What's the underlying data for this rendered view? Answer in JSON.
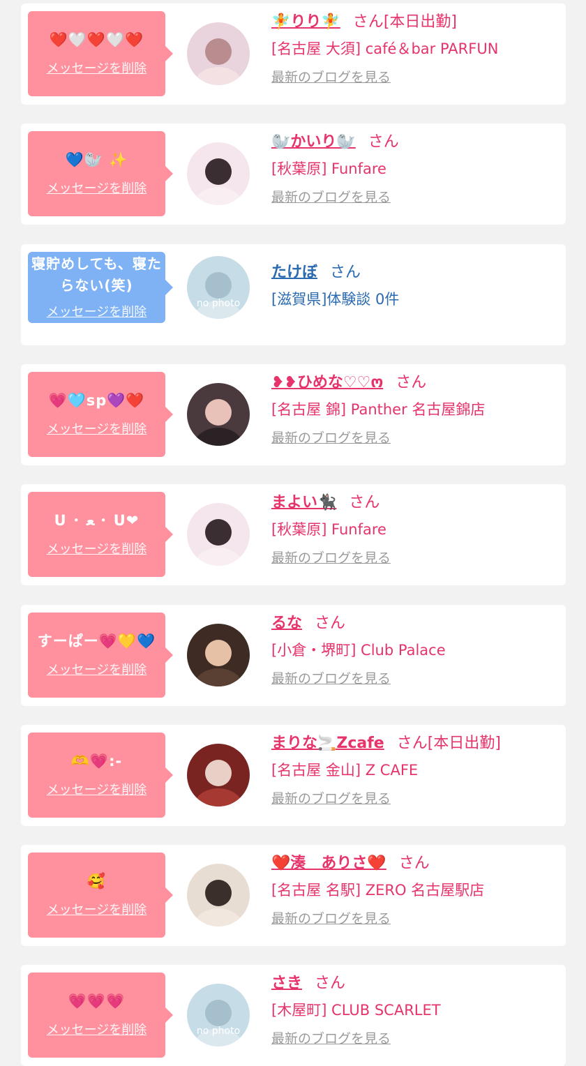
{
  "delete_label": "メッセージを削除",
  "san_label": "さん",
  "blog_label": "最新のブログを見る",
  "colors": {
    "page_bg": "#f2f2f2",
    "card_bg": "#ffffff",
    "female_bubble": "#ff919f",
    "male_bubble": "#7eb2f5",
    "name_pink": "#e6346b",
    "name_blue": "#2a6ab0",
    "blog_gray": "#9a9a9a"
  },
  "messages": [
    {
      "type": "female",
      "message": "❤️🤍❤️🤍❤️",
      "name": "🧚りり🧚",
      "badge": "[本日出勤]",
      "shop": "[名古屋 大須] café＆bar PARFUN",
      "avatar": "photo-avatar-pink",
      "blog": true
    },
    {
      "type": "female",
      "message": "💙🦭 ✨",
      "name": "🦭かいり🦭",
      "badge": "",
      "shop": "[秋葉原] Funfare",
      "avatar": "photo-avatar-lightpink",
      "blog": true
    },
    {
      "type": "male",
      "message": "寝貯めしても、寝たらない(笑)",
      "name": "たけぼ",
      "badge": "",
      "shop": "[滋賀県]体験談 0件",
      "avatar": "no-photo-avatar",
      "avatar_text": "no photo",
      "blog": false
    },
    {
      "type": "female",
      "message": "💗🩵sp💜❤️",
      "name": "❥❥ひめな♡♡ო",
      "badge": "",
      "shop": "[名古屋 錦] Panther 名古屋錦店",
      "avatar": "photo-avatar-dark",
      "blog": true
    },
    {
      "type": "female",
      "message": "U ･ ﻌ ･ U❤",
      "name": "まよい🐈‍⬛",
      "badge": "",
      "shop": "[秋葉原] Funfare",
      "avatar": "photo-avatar-lightpink",
      "blog": true
    },
    {
      "type": "female",
      "message": "すーぱー💗💛💙",
      "name": "るな",
      "badge": "",
      "shop": "[小倉・堺町] Club Palace",
      "avatar": "photo-avatar-brown",
      "blog": true
    },
    {
      "type": "female",
      "message": "🫶💗⁠:-",
      "name": "まりな🚬Zcafe",
      "badge": "[本日出勤]",
      "shop": "[名古屋 金山] Z CAFE",
      "avatar": "photo-avatar-red",
      "blog": true
    },
    {
      "type": "female",
      "message": "🥰",
      "name": "❤️湊　ありさ❤️",
      "badge": "",
      "shop": "[名古屋 名駅] ZERO 名古屋駅店",
      "avatar": "photo-avatar-beige",
      "blog": true
    },
    {
      "type": "female",
      "message": "💗💗💗",
      "name": "さき",
      "badge": "",
      "shop": "[木屋町] CLUB SCARLET",
      "avatar": "no-photo-avatar",
      "avatar_text": "no photo",
      "blog": true
    }
  ]
}
